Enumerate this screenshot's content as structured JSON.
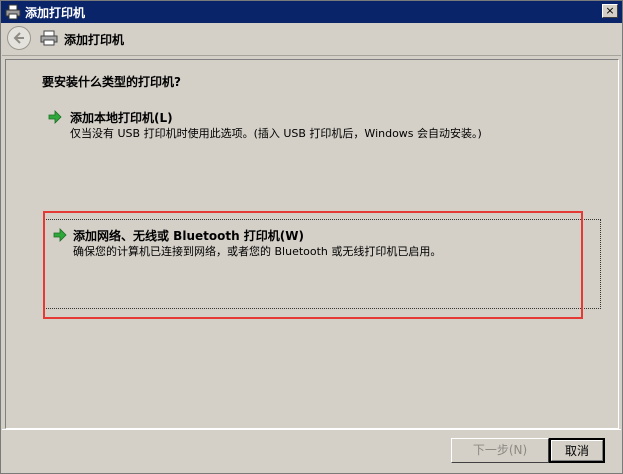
{
  "window": {
    "title": "添加打印机",
    "close_glyph": "×"
  },
  "nav": {
    "title": "添加打印机"
  },
  "main": {
    "question": "要安装什么类型的打印机?",
    "options": [
      {
        "title": "添加本地打印机(L)",
        "description": "仅当没有 USB 打印机时使用此选项。(插入 USB 打印机后，Windows 会自动安装。)"
      },
      {
        "title": "添加网络、无线或 Bluetooth 打印机(W)",
        "description": "确保您的计算机已连接到网络，或者您的 Bluetooth 或无线打印机已启用。"
      }
    ]
  },
  "footer": {
    "next_label": "下一步(N)",
    "cancel_label": "取消"
  },
  "colors": {
    "titlebar": "#0a246a",
    "window_bg": "#d4d0c8",
    "highlight": "#e53935",
    "arrow_green": "#2ea83a"
  },
  "icons": {
    "title": "printer-icon",
    "back": "back-arrow-icon",
    "option": "green-arrow-icon"
  }
}
